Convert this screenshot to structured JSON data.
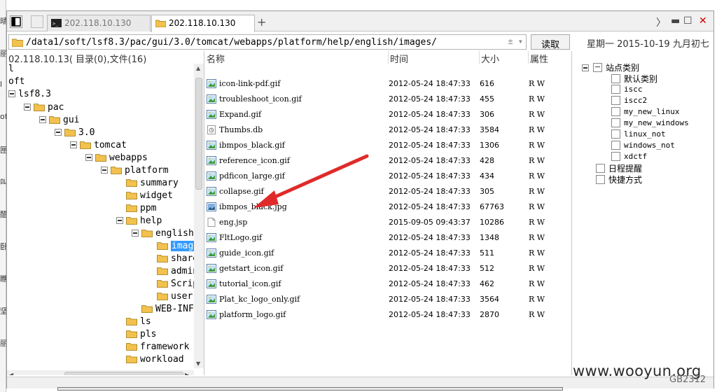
{
  "sliver_chars": [
    "晴",
    "丽",
    "l",
    "oft",
    "匣",
    "叫",
    "醋",
    "卧",
    "瞧",
    "坚",
    "丽"
  ],
  "tabs": [
    {
      "label": "",
      "kind": "toggle"
    },
    {
      "label": "",
      "kind": "blank"
    },
    {
      "label": "202.118.10.130",
      "kind": "terminal",
      "active": false
    },
    {
      "label": "202.118.10.130",
      "kind": "folder",
      "active": true
    }
  ],
  "address": {
    "path": "/data1/soft/lsf8.3/pac/gui/3.0/tomcat/webapps/platform/help/english/images/",
    "spin": "± ▾"
  },
  "read_button": "读取",
  "date_text": "星期一  2015-10-19  九月初七",
  "left_header": "02.118.10.13( 目录(0),文件(16)",
  "tree": [
    {
      "label": "l",
      "depth": 0,
      "toggle": false,
      "folder": false
    },
    {
      "label": "oft",
      "depth": 0,
      "toggle": false,
      "folder": false
    },
    {
      "label": "lsf8.3",
      "depth": 0,
      "toggle": true,
      "folder": false
    },
    {
      "label": "pac",
      "depth": 1,
      "toggle": true,
      "folder": true
    },
    {
      "label": "gui",
      "depth": 2,
      "toggle": true,
      "folder": true
    },
    {
      "label": "3.0",
      "depth": 3,
      "toggle": true,
      "folder": true
    },
    {
      "label": "tomcat",
      "depth": 4,
      "toggle": true,
      "folder": true
    },
    {
      "label": "webapps",
      "depth": 5,
      "toggle": true,
      "folder": true
    },
    {
      "label": "platform",
      "depth": 6,
      "toggle": true,
      "folder": true
    },
    {
      "label": "summary",
      "depth": 7,
      "toggle": false,
      "folder": true
    },
    {
      "label": "widget",
      "depth": 7,
      "toggle": false,
      "folder": true
    },
    {
      "label": "ppm",
      "depth": 7,
      "toggle": false,
      "folder": true
    },
    {
      "label": "help",
      "depth": 7,
      "toggle": true,
      "folder": true
    },
    {
      "label": "english",
      "depth": 8,
      "toggle": true,
      "folder": true
    },
    {
      "label": "images",
      "depth": 9,
      "toggle": false,
      "folder": true,
      "selected": true
    },
    {
      "label": "share",
      "depth": 9,
      "toggle": false,
      "folder": true
    },
    {
      "label": "admin",
      "depth": 9,
      "toggle": false,
      "folder": true
    },
    {
      "label": "Scripts",
      "depth": 9,
      "toggle": false,
      "folder": true
    },
    {
      "label": "user",
      "depth": 9,
      "toggle": false,
      "folder": true
    },
    {
      "label": "WEB-INF",
      "depth": 8,
      "toggle": false,
      "folder": true
    },
    {
      "label": "ls",
      "depth": 7,
      "toggle": false,
      "folder": true
    },
    {
      "label": "pls",
      "depth": 7,
      "toggle": false,
      "folder": true
    },
    {
      "label": "framework",
      "depth": 7,
      "toggle": false,
      "folder": true
    },
    {
      "label": "workload",
      "depth": 7,
      "toggle": false,
      "folder": true
    }
  ],
  "file_columns": [
    "名称",
    "时间",
    "大小",
    "属性"
  ],
  "files": [
    {
      "name": "icon-link-pdf.gif",
      "time": "2012-05-24 18:47:33",
      "size": "616",
      "attr": "R W",
      "icon": "image-icon"
    },
    {
      "name": "troubleshoot_icon.gif",
      "time": "2012-05-24 18:47:33",
      "size": "455",
      "attr": "R W",
      "icon": "image-icon"
    },
    {
      "name": "Expand.gif",
      "time": "2012-05-24 18:47:33",
      "size": "306",
      "attr": "R W",
      "icon": "image-icon"
    },
    {
      "name": "Thumbs.db",
      "time": "2012-05-24 18:47:33",
      "size": "3584",
      "attr": "R W",
      "icon": "db-icon"
    },
    {
      "name": "ibmpos_black.gif",
      "time": "2012-05-24 18:47:33",
      "size": "1306",
      "attr": "R W",
      "icon": "image-icon"
    },
    {
      "name": "reference_icon.gif",
      "time": "2012-05-24 18:47:33",
      "size": "428",
      "attr": "R W",
      "icon": "image-icon"
    },
    {
      "name": "pdficon_large.gif",
      "time": "2012-05-24 18:47:33",
      "size": "434",
      "attr": "R W",
      "icon": "image-icon"
    },
    {
      "name": "collapse.gif",
      "time": "2012-05-24 18:47:33",
      "size": "305",
      "attr": "R W",
      "icon": "image-icon"
    },
    {
      "name": "ibmpos_black.jpg",
      "time": "2012-05-24 18:47:33",
      "size": "67763",
      "attr": "R W",
      "icon": "photo-icon"
    },
    {
      "name": "eng.jsp",
      "time": "2015-09-05 09:43:37",
      "size": "10286",
      "attr": "R W",
      "icon": "file-icon"
    },
    {
      "name": "FltLogo.gif",
      "time": "2012-05-24 18:47:33",
      "size": "1348",
      "attr": "R W",
      "icon": "image-icon"
    },
    {
      "name": "guide_icon.gif",
      "time": "2012-05-24 18:47:33",
      "size": "511",
      "attr": "R W",
      "icon": "image-icon"
    },
    {
      "name": "getstart_icon.gif",
      "time": "2012-05-24 18:47:33",
      "size": "512",
      "attr": "R W",
      "icon": "image-icon"
    },
    {
      "name": "tutorial_icon.gif",
      "time": "2012-05-24 18:47:33",
      "size": "462",
      "attr": "R W",
      "icon": "image-icon"
    },
    {
      "name": "Plat_kc_logo_only.gif",
      "time": "2012-05-24 18:47:33",
      "size": "3564",
      "attr": "R W",
      "icon": "image-icon"
    },
    {
      "name": "platform_logo.gif",
      "time": "2012-05-24 18:47:33",
      "size": "2870",
      "attr": "R W",
      "icon": "image-icon"
    }
  ],
  "right_tree": [
    {
      "label": "站点类别",
      "depth": 0,
      "toggle": true,
      "mono": false
    },
    {
      "label": "默认类别",
      "depth": 1,
      "toggle": false,
      "mono": false
    },
    {
      "label": "iscc",
      "depth": 1,
      "toggle": false,
      "mono": true
    },
    {
      "label": "iscc2",
      "depth": 1,
      "toggle": false,
      "mono": true
    },
    {
      "label": "my_new_linux",
      "depth": 1,
      "toggle": false,
      "mono": true
    },
    {
      "label": "my_new_windows",
      "depth": 1,
      "toggle": false,
      "mono": true
    },
    {
      "label": "linux_not",
      "depth": 1,
      "toggle": false,
      "mono": true
    },
    {
      "label": "windows_not",
      "depth": 1,
      "toggle": false,
      "mono": true
    },
    {
      "label": "xdctf",
      "depth": 1,
      "toggle": false,
      "mono": true
    },
    {
      "label": "日程提醒",
      "depth": 0,
      "toggle": false,
      "mono": false
    },
    {
      "label": "快捷方式",
      "depth": 0,
      "toggle": false,
      "mono": false
    }
  ],
  "watermark": "www.wooyun.org",
  "encoding": "GB2312",
  "colors": {
    "selection": "#3399ff",
    "arrow": "#e02a2a",
    "folder": "#f2c14e"
  }
}
